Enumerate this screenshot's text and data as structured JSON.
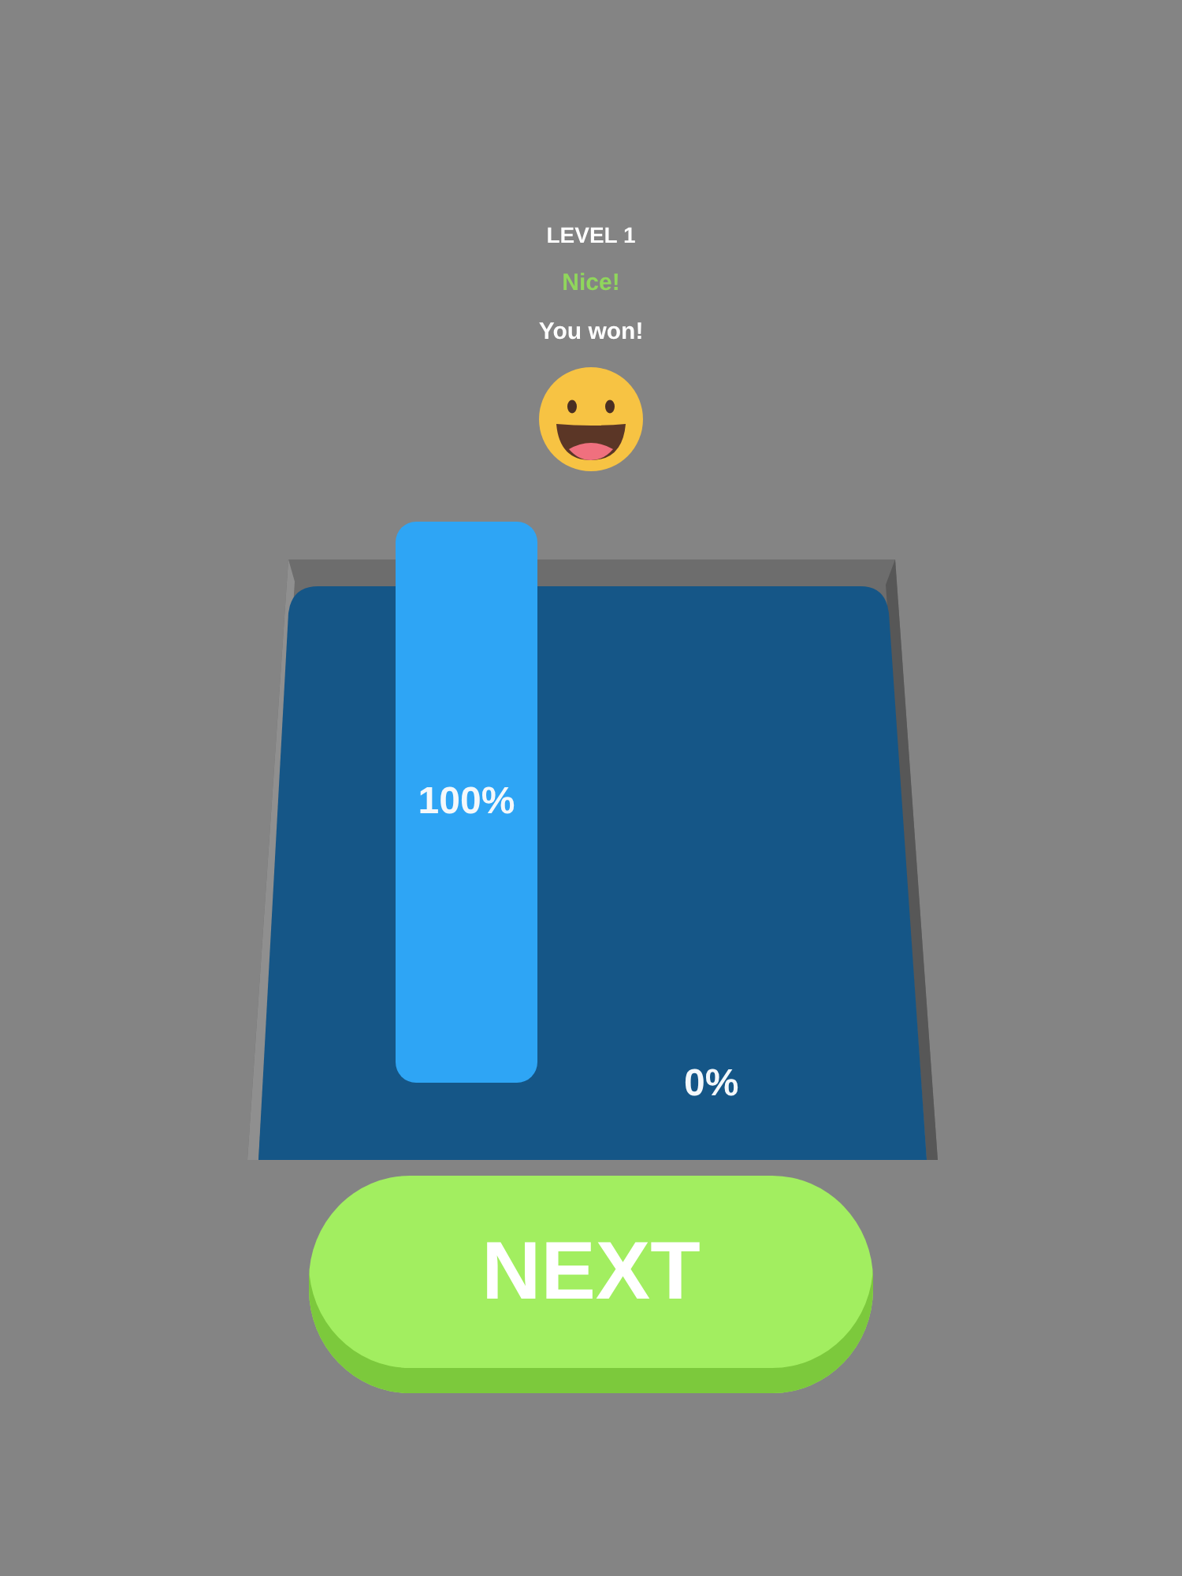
{
  "header": {
    "level": "LEVEL 1",
    "praise": "Nice!",
    "message": "You won!"
  },
  "pit": {
    "pillar": {
      "reading": "100%"
    },
    "floor_reading": "0%"
  },
  "next_button": {
    "label": "NEXT"
  }
}
